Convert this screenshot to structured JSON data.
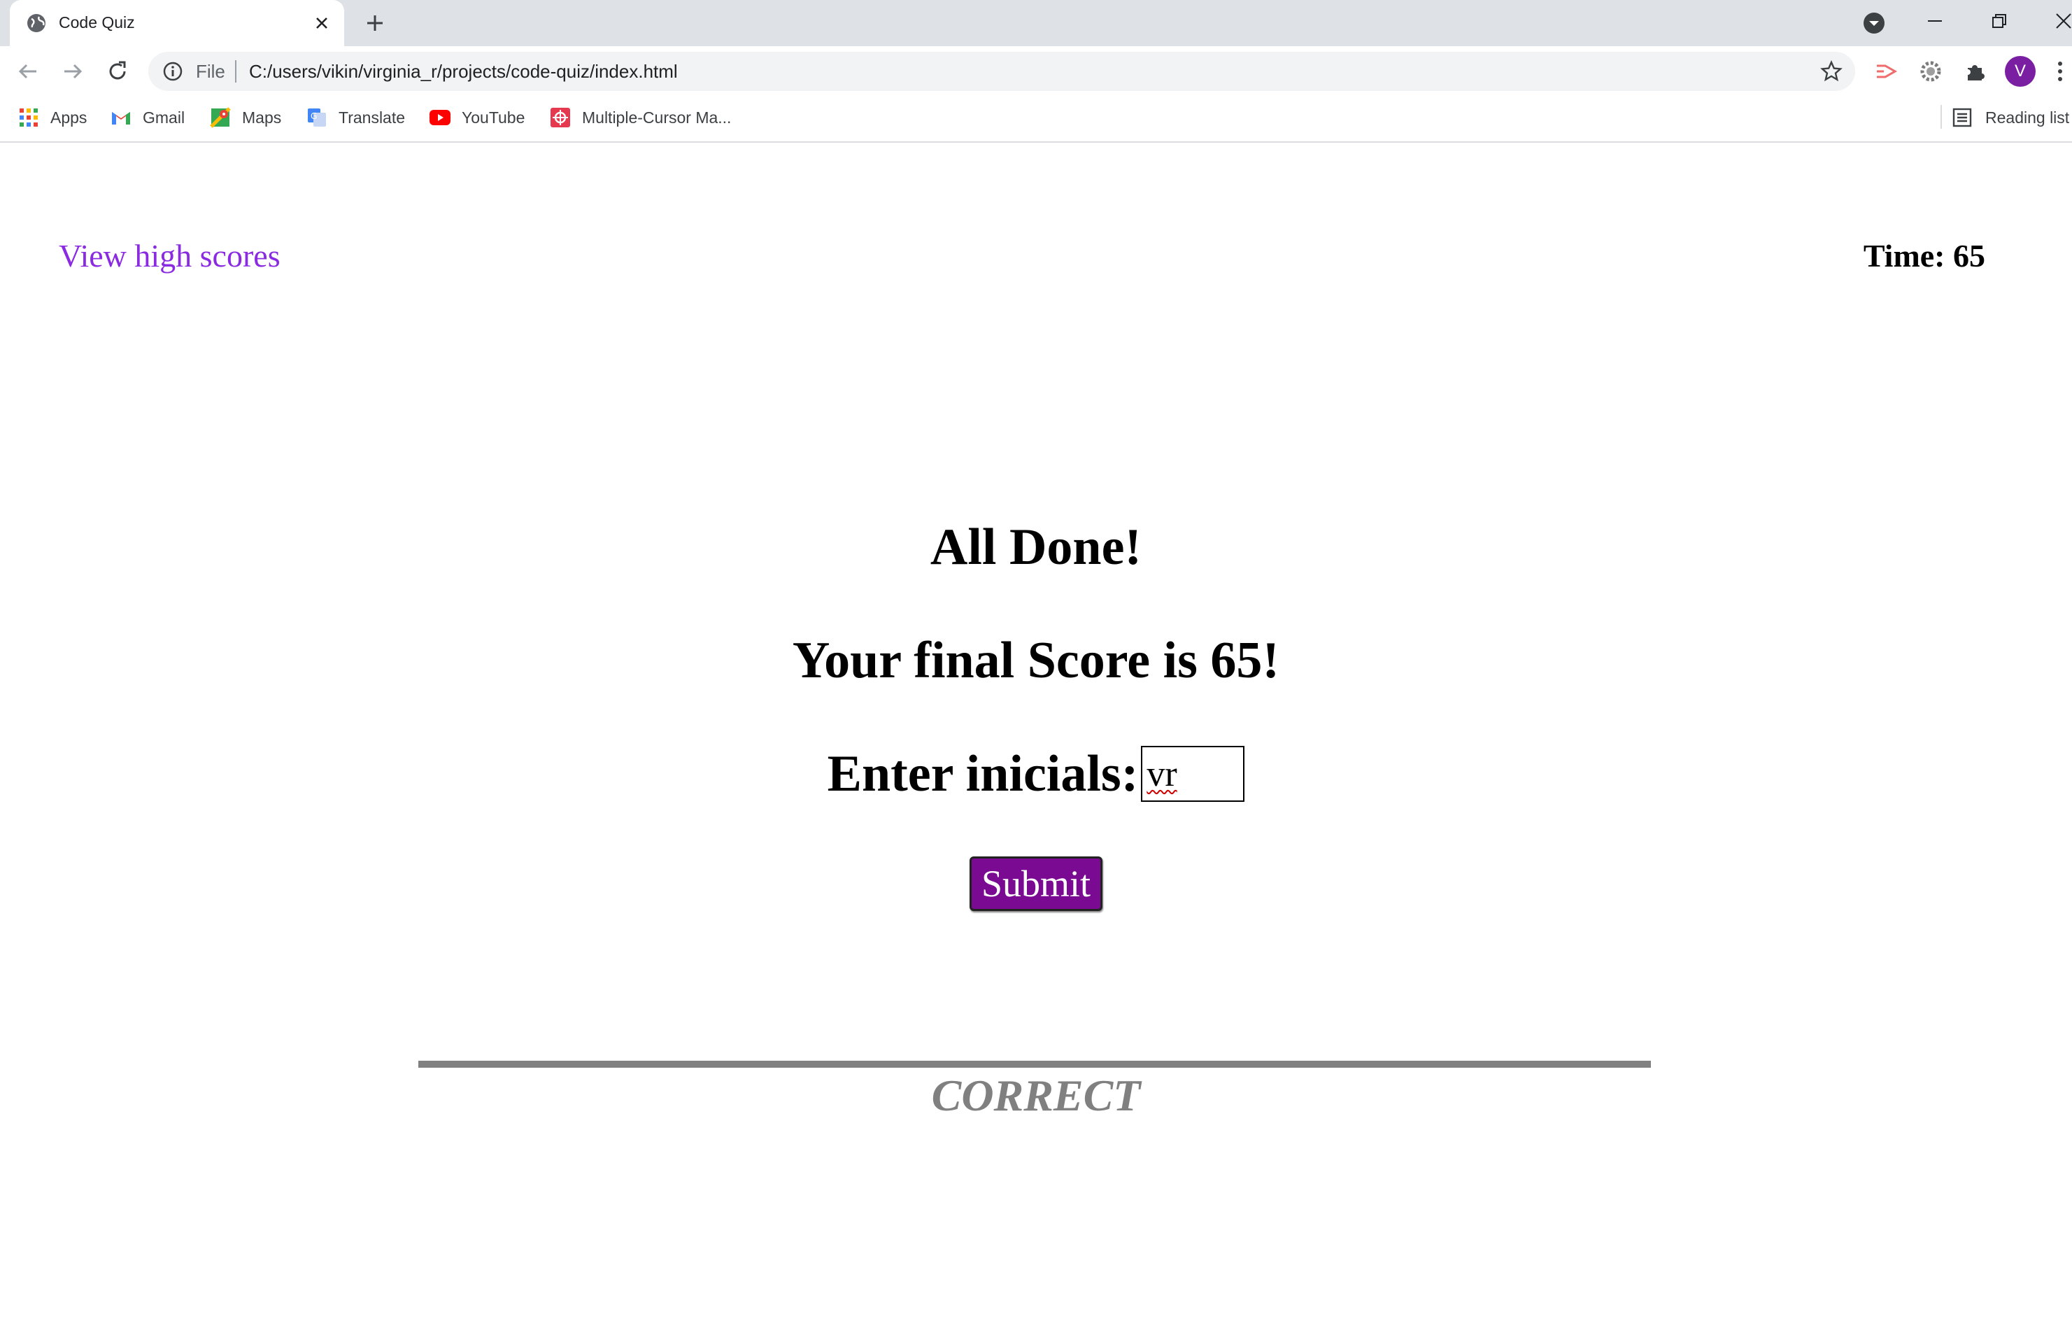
{
  "browser": {
    "tab_title": "Code Quiz",
    "address_scheme_label": "File",
    "url": "C:/users/vikin/virginia_r/projects/code-quiz/index.html",
    "avatar_letter": "V",
    "bookmarks": [
      {
        "label": "Apps",
        "icon": "apps-grid-icon"
      },
      {
        "label": "Gmail",
        "icon": "gmail-icon"
      },
      {
        "label": "Maps",
        "icon": "maps-icon"
      },
      {
        "label": "Translate",
        "icon": "translate-icon"
      },
      {
        "label": "YouTube",
        "icon": "youtube-icon"
      },
      {
        "label": "Multiple-Cursor Ma...",
        "icon": "extension-page-icon"
      }
    ],
    "reading_list_label": "Reading list"
  },
  "quiz": {
    "high_scores_link": "View high scores",
    "timer_text": "Time: 65",
    "done_title": "All Done!",
    "final_score_text": "Your final Score is 65!",
    "initials_label": "Enter inicials:",
    "initials_value": "vr",
    "submit_label": "Submit",
    "feedback_text": "CORRECT"
  },
  "colors": {
    "link": "#8a2be2",
    "submit_bg": "#7a0a91",
    "feedback": "#808080",
    "avatar": "#7b1fa2"
  }
}
